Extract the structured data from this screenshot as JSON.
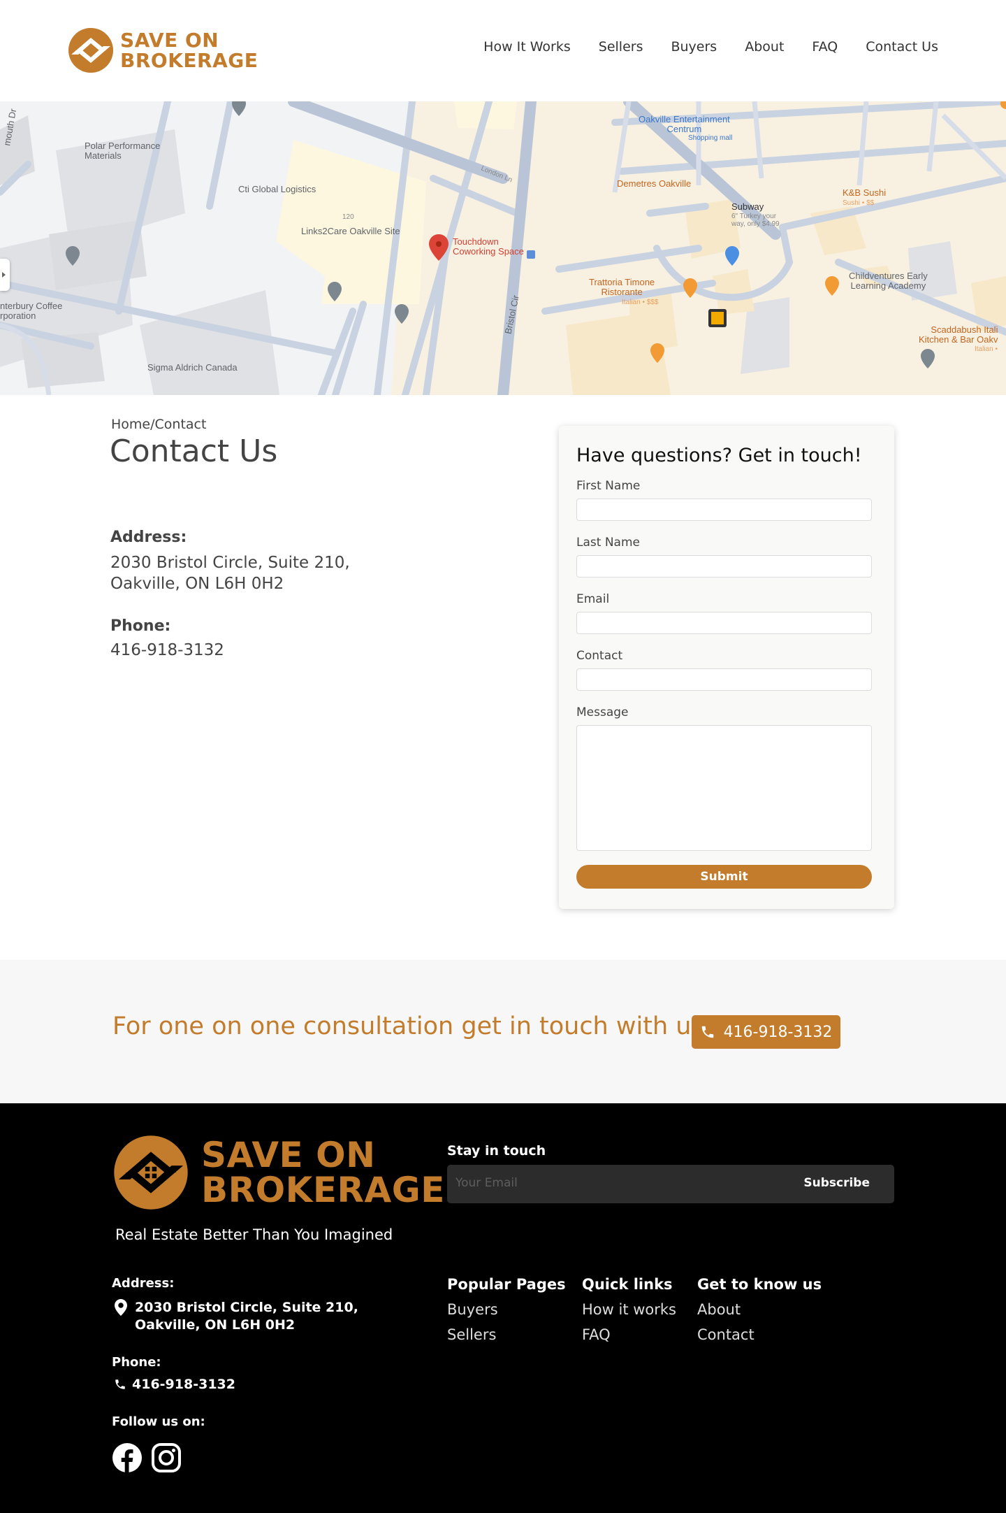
{
  "brand": {
    "name_line1": "SAVE ON",
    "name_line2": "BROKERAGE",
    "color": "#c27c2c",
    "tagline": "Real Estate Better Than You Imagined"
  },
  "nav": [
    "How It Works",
    "Sellers",
    "Buyers",
    "About",
    "FAQ",
    "Contact Us"
  ],
  "map": {
    "labels": {
      "polar": "Polar Performance\nMaterials",
      "cti": "Cti Global Logistics",
      "num120": "120",
      "links2care": "Links2Care Oakville Site",
      "touchdown": "Touchdown\nCoworking Space",
      "canterbury": "nterbury Coffee\nrporation",
      "sigma": "Sigma Aldrich Canada",
      "london": "London Ln",
      "bristol": "Bristol Cir",
      "oakville_ent": "Oakville Entertainment\nCentrum",
      "shopping_mall": "Shopping mall",
      "demetres": "Demetres Oakville",
      "subway": "Subway",
      "subway_sub": "6\" Turkey your\nway, only $4.99",
      "kb_sushi": "K&B Sushi",
      "kb_sub": "Sushi • $$",
      "trattoria": "Trattoria Timone\nRistorante",
      "trattoria_sub": "Italian • $$$",
      "childventures": "Childventures Early\nLearning Academy",
      "scaddabush": "Scaddabush Itali\nKitchen & Bar Oakv",
      "scaddabush_sub": "Italian •",
      "mouth": "mouth Dr"
    }
  },
  "breadcrumb": "Home/Contact",
  "page_title": "Contact Us",
  "contact": {
    "address_label": "Address:",
    "address_line1": "2030 Bristol Circle, Suite 210,",
    "address_line2": "Oakville, ON L6H 0H2",
    "phone_label": "Phone:",
    "phone": "416-918-3132"
  },
  "form": {
    "title": "Have questions? Get in touch!",
    "fields": [
      "First Name",
      "Last Name",
      "Email",
      "Contact",
      "Message"
    ],
    "submit": "Submit"
  },
  "consult": {
    "text": "For one on one consultation get in touch with us",
    "phone": "416-918-3132"
  },
  "footer": {
    "stay_label": "Stay in touch",
    "email_placeholder": "Your Email",
    "subscribe": "Subscribe",
    "address_label": "Address:",
    "address_line1": "2030 Bristol Circle, Suite 210,",
    "address_line2": "Oakville, ON L6H 0H2",
    "phone_label": "Phone:",
    "phone": "416-918-3132",
    "follow_label": "Follow us on:",
    "columns": [
      {
        "title": "Popular Pages",
        "links": [
          "Buyers",
          "Sellers"
        ]
      },
      {
        "title": "Quick links",
        "links": [
          "How it works",
          "FAQ"
        ]
      },
      {
        "title": "Get to know us",
        "links": [
          "About",
          "Contact"
        ]
      }
    ],
    "social_icons": [
      "facebook-icon",
      "instagram-icon"
    ]
  }
}
